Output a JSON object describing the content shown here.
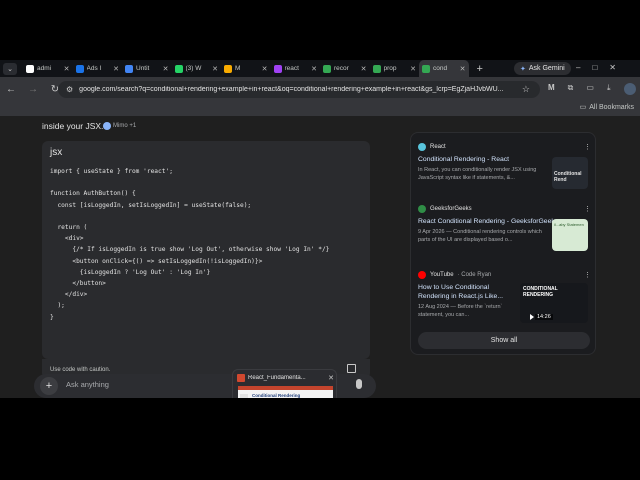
{
  "tabs": [
    {
      "label": "admi",
      "color": "#ffffff"
    },
    {
      "label": "Ads I",
      "color": "#1a73e8"
    },
    {
      "label": "Untit",
      "color": "#4285f4"
    },
    {
      "label": "(3) W",
      "color": "#25d366"
    },
    {
      "label": "M",
      "color": "#f9ab00"
    },
    {
      "label": "react",
      "color": "#a142f4"
    },
    {
      "label": "recor",
      "color": "#34a853"
    },
    {
      "label": "prop",
      "color": "#34a853"
    },
    {
      "label": "cond",
      "color": "#34a853"
    }
  ],
  "ask_gemini_label": "Ask Gemini",
  "url": "google.com/search?q=conditional+rendering+example+in+react&oq=conditional+rendering+example+in+react&gs_lcrp=EgZjaHJvbWU...",
  "all_bookmarks_label": "All Bookmarks",
  "answer": {
    "intro_text": "inside your JSX.",
    "mimo_label": "Mimo +1"
  },
  "code": {
    "lang": "jsx",
    "lines": [
      "import { useState } from 'react';",
      "",
      "function AuthButton() {",
      "  const [isLoggedIn, setIsLoggedIn] = useState(false);",
      "",
      "  return (",
      "    <div>",
      "      {/* If isLoggedIn is true show 'Log Out', otherwise show 'Log In' */}",
      "      <button onClick={() => setIsLoggedIn(!isLoggedIn)}>",
      "        {isLoggedIn ? 'Log Out' : 'Log In'}",
      "      </button>",
      "    </div>",
      "  );",
      "}"
    ],
    "caution_label": "Use code with caution."
  },
  "sources": [
    {
      "site": "React",
      "site_sub": "",
      "fav_color": "#58c4dc",
      "title": "Conditional Rendering - React",
      "snippet": "In React, you can conditionally render JSX using JavaScript syntax like if statements, &...",
      "thumb_text": "Conditional Rend"
    },
    {
      "site": "GeeksforGeeks",
      "site_sub": "",
      "fav_color": "#2f8d46",
      "title": "React Conditional Rendering - GeeksforGeeks",
      "snippet": "9 Apr 2026 — Conditional rendering controls which parts of the UI are displayed based o...",
      "thumb_text": "il...aby Statemen"
    },
    {
      "site": "YouTube",
      "site_sub": "· Code Ryan",
      "fav_color": "#ff0000",
      "title": "How to Use Conditional Rendering in React.js Like...",
      "snippet": "12 Aug 2024 — Before the `return` statement, you can...",
      "video_title": "CONDITIONAL RENDERING",
      "duration": "14:26"
    }
  ],
  "show_all_label": "Show all",
  "ask_placeholder": "Ask anything",
  "preview": {
    "title": "React_Fundamenta...",
    "slide_heading": "Conditional Rendering"
  }
}
